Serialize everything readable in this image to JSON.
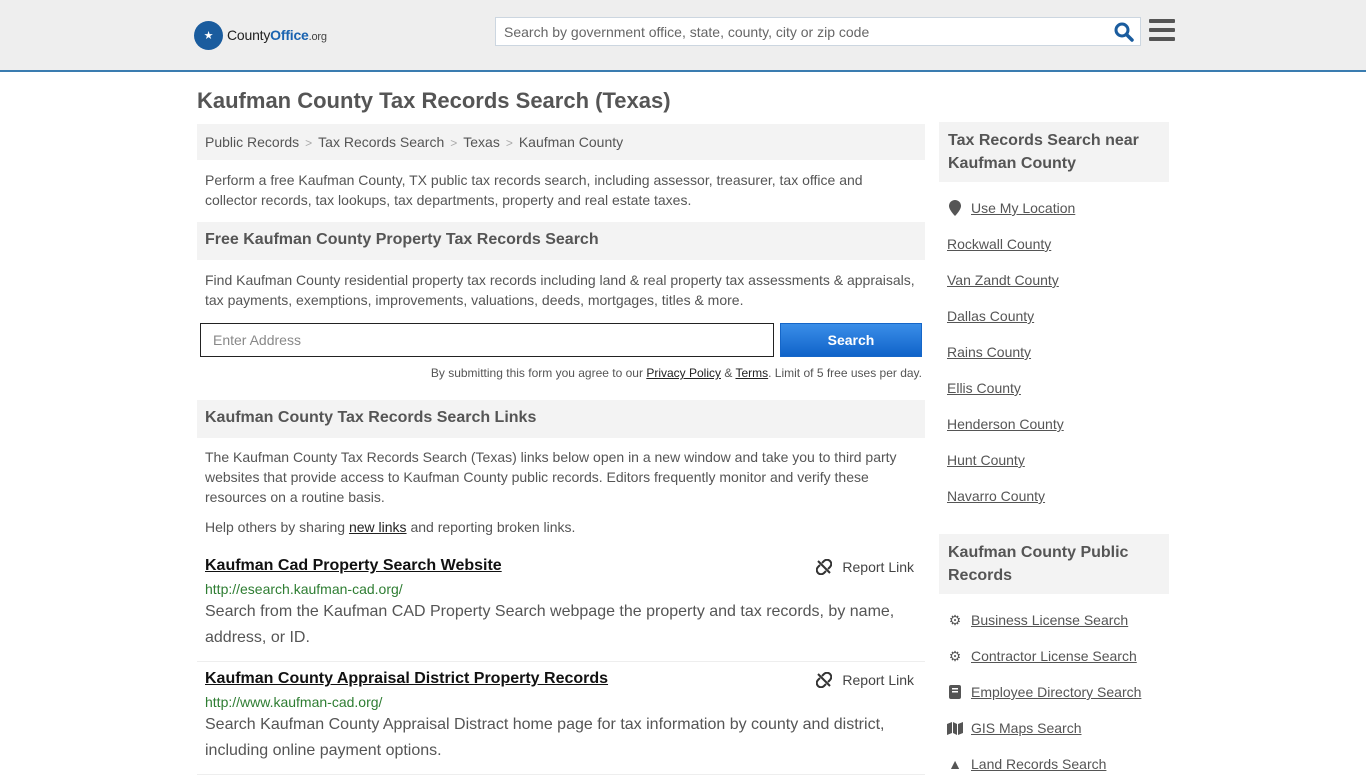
{
  "header": {
    "logo": {
      "brand_prefix": "County",
      "brand_main": "Office",
      "brand_suffix": ".org"
    },
    "search": {
      "placeholder": "Search by government office, state, county, city or zip code"
    },
    "accent_color": "#3a7cb0"
  },
  "page": {
    "title": "Kaufman County Tax Records Search (Texas)"
  },
  "breadcrumb": [
    "Public Records",
    "Tax Records Search",
    "Texas",
    "Kaufman County"
  ],
  "intro": "Perform a free Kaufman County, TX public tax records search, including assessor, treasurer, tax office and collector records, tax lookups, tax departments, property and real estate taxes.",
  "property_search": {
    "heading": "Free Kaufman County Property Tax Records Search",
    "description": "Find Kaufman County residential property tax records including land & real property tax assessments & appraisals, tax payments, exemptions, improvements, valuations, deeds, mortgages, titles & more.",
    "address_placeholder": "Enter Address",
    "button_label": "Search",
    "disclaimer_prefix": "By submitting this form you agree to our ",
    "privacy_label": "Privacy Policy",
    "amp": " & ",
    "terms_label": "Terms",
    "disclaimer_suffix": ". Limit of 5 free uses per day."
  },
  "links_section": {
    "heading": "Kaufman County Tax Records Search Links",
    "description": "The Kaufman County Tax Records Search (Texas) links below open in a new window and take you to third party websites that provide access to Kaufman County public records. Editors frequently monitor and verify these resources on a routine basis.",
    "help_prefix": "Help others by sharing ",
    "help_link": "new links",
    "help_suffix": " and reporting broken links.",
    "report_label": "Report Link",
    "items": [
      {
        "title": "Kaufman Cad Property Search Website",
        "url": "http://esearch.kaufman-cad.org/",
        "description": "Search from the Kaufman CAD Property Search webpage the property and tax records, by name, address, or ID."
      },
      {
        "title": "Kaufman County Appraisal District Property Records",
        "url": "http://www.kaufman-cad.org/",
        "description": "Search Kaufman County Appraisal Distract home page for tax information by county and district, including online payment options."
      }
    ]
  },
  "sidebar": {
    "nearby": {
      "heading": "Tax Records Search near Kaufman County",
      "use_location": "Use My Location",
      "counties": [
        "Rockwall County",
        "Van Zandt County",
        "Dallas County",
        "Rains County",
        "Ellis County",
        "Henderson County",
        "Hunt County",
        "Navarro County"
      ]
    },
    "public_records": {
      "heading": "Kaufman County Public Records",
      "items": [
        {
          "label": "Business License Search",
          "icon": "cogs-icon"
        },
        {
          "label": "Contractor License Search",
          "icon": "gear-icon"
        },
        {
          "label": "Employee Directory Search",
          "icon": "book-icon"
        },
        {
          "label": "GIS Maps Search",
          "icon": "map-icon"
        },
        {
          "label": "Land Records Search",
          "icon": "tree-icon"
        }
      ]
    }
  }
}
